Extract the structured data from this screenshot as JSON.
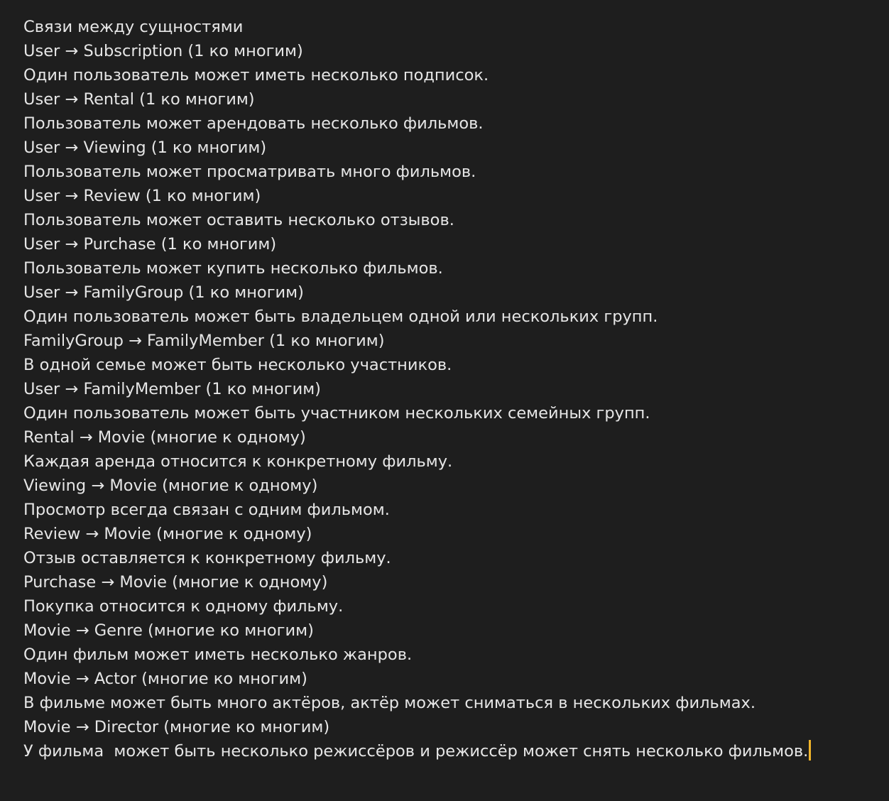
{
  "editor": {
    "lines": [
      "Связи между сущностями",
      "User → Subscription (1 ко многим)",
      "Один пользователь может иметь несколько подписок.",
      "User → Rental (1 ко многим)",
      "Пользователь может арендовать несколько фильмов.",
      "User → Viewing (1 ко многим)",
      "Пользователь может просматривать много фильмов.",
      "User → Review (1 ко многим)",
      "Пользователь может оставить несколько отзывов.",
      "User → Purchase (1 ко многим)",
      "Пользователь может купить несколько фильмов.",
      "User → FamilyGroup (1 ко многим)",
      "Один пользователь может быть владельцем одной или нескольких групп.",
      "FamilyGroup → FamilyMember (1 ко многим)",
      "В одной семье может быть несколько участников.",
      "User → FamilyMember (1 ко многим)",
      "Один пользователь может быть участником нескольких семейных групп.",
      "Rental → Movie (многие к одному)",
      "Каждая аренда относится к конкретному фильму.",
      "Viewing → Movie (многие к одному)",
      "Просмотр всегда связан с одним фильмом.",
      "Review → Movie (многие к одному)",
      "Отзыв оставляется к конкретному фильму.",
      "Purchase → Movie (многие к одному)",
      "Покупка относится к одному фильму.",
      "Movie → Genre (многие ко многим)",
      "Один фильм может иметь несколько жанров.",
      "Movie → Actor (многие ко многим)",
      "В фильме может быть много актёров, актёр может сниматься в нескольких фильмах.",
      "Movie → Director (многие ко многим)",
      "У фильма  может быть несколько режиссёров и режиссёр может снять несколько фильмов."
    ],
    "cursor_color": "#f0b429",
    "text_color": "#e6e6e6",
    "background_color": "#1e1e1e"
  }
}
